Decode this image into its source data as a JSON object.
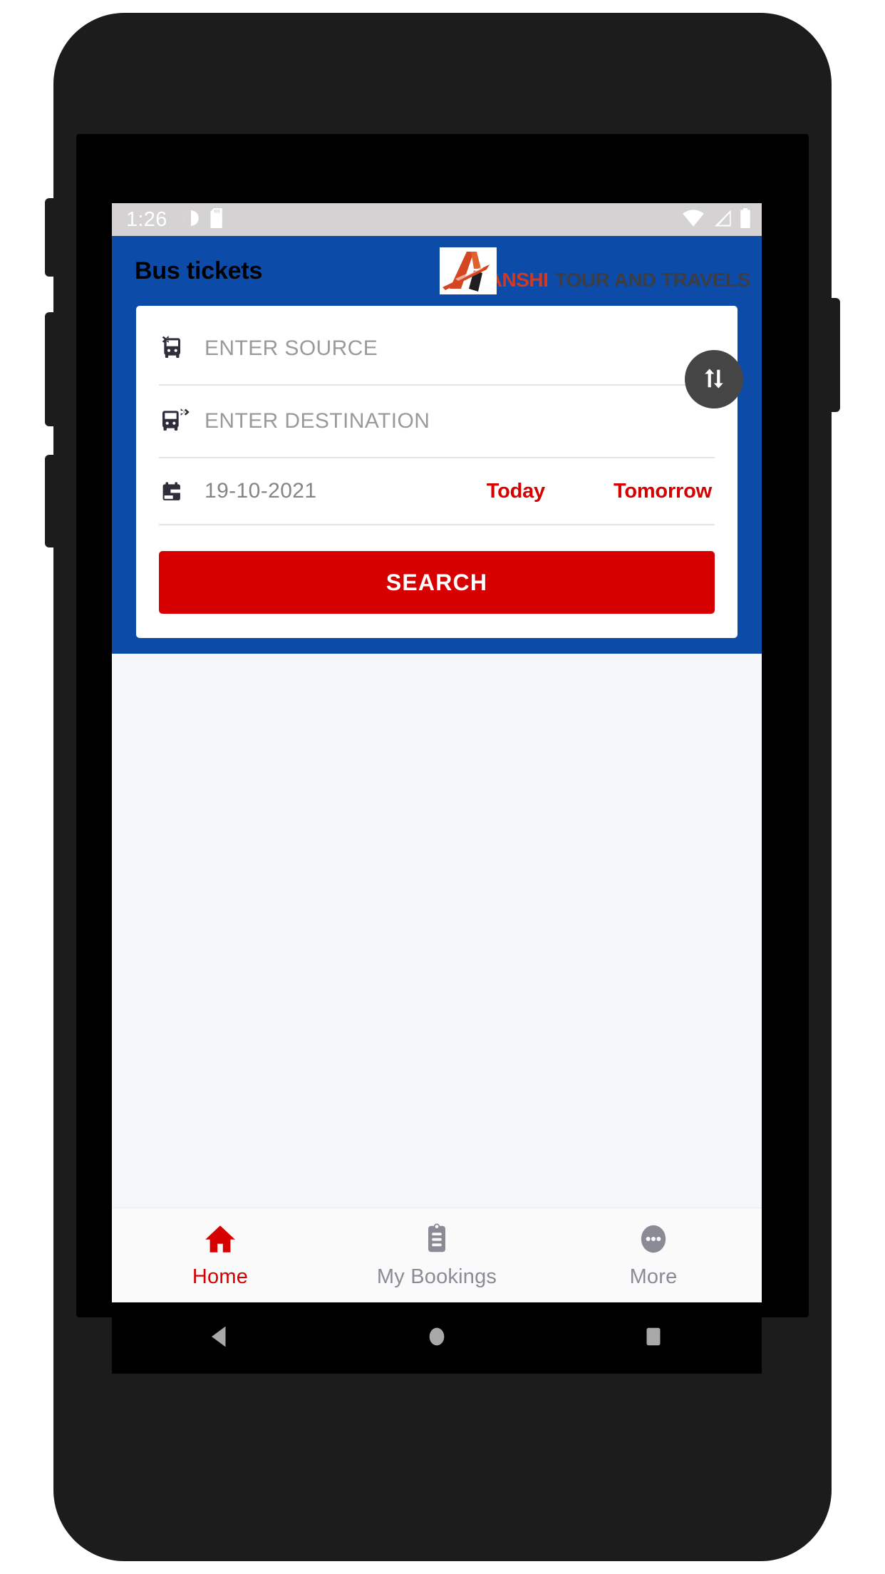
{
  "status_bar": {
    "time": "1:26",
    "left_icons": [
      "do-not-disturb-icon",
      "sd-card-icon"
    ],
    "right_icons": [
      "wifi-icon",
      "cellular-signal-icon",
      "battery-icon"
    ],
    "background_color": "#d4d2d2",
    "icon_color": "#ffffff"
  },
  "app_bar": {
    "title": "Bus tickets",
    "background_color": "#0d4ba8",
    "title_color": "#000000",
    "brand": {
      "logo_icon": "anshi-a-logo-icon",
      "name_part_1": "ANSHI",
      "name_part_2": "TOUR AND TRAVELS",
      "name_part_1_color": "#d4381f",
      "name_part_2_color": "#3d3d42"
    }
  },
  "search_card": {
    "source": {
      "icon": "bus-departure-icon",
      "value": "",
      "placeholder": "ENTER SOURCE"
    },
    "destination": {
      "icon": "bus-arrival-icon",
      "value": "",
      "placeholder": "ENTER DESTINATION"
    },
    "swap_button": {
      "icon": "swap-vertical-arrows-icon",
      "background_color": "#454545"
    },
    "date": {
      "icon": "calendar-icon",
      "value": "19-10-2021",
      "quick_today": "Today",
      "quick_tomorrow": "Tomorrow",
      "quick_color": "#d60000"
    },
    "search_button": {
      "label": "SEARCH",
      "background_color": "#d60000",
      "text_color": "#ffffff"
    }
  },
  "bottom_nav": {
    "items": [
      {
        "label": "Home",
        "icon": "home-icon",
        "active": true,
        "color": "#d60000"
      },
      {
        "label": "My Bookings",
        "icon": "clipboard-icon",
        "active": false,
        "color": "#8b8b96"
      },
      {
        "label": "More",
        "icon": "more-dots-circle-icon",
        "active": false,
        "color": "#8b8b96"
      }
    ]
  },
  "android_nav": {
    "back": "back-triangle-icon",
    "home": "home-circle-icon",
    "recents": "recents-square-icon",
    "icon_color": "#a8a8a8"
  }
}
